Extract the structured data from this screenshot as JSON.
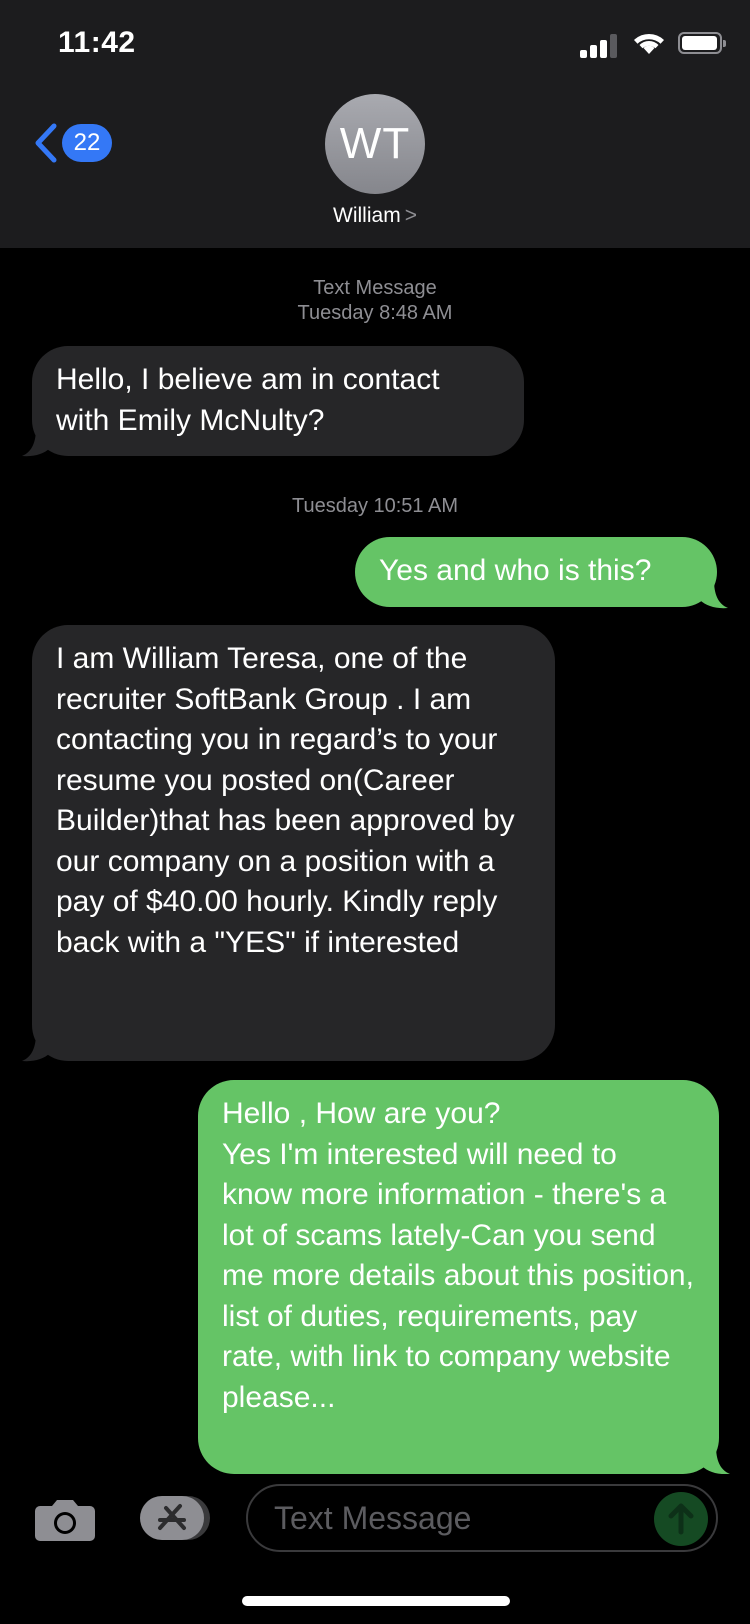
{
  "status_bar": {
    "time": "11:42"
  },
  "header": {
    "back_count": "22",
    "avatar_initials": "WT",
    "contact_name": "William",
    "contact_chevron": ">"
  },
  "conversation": {
    "service_label": "Text Message",
    "timestamps": [
      "Tuesday 8:48 AM",
      "Tuesday 10:51 AM"
    ],
    "messages": [
      {
        "direction": "incoming",
        "text": "Hello, I believe am in contact with Emily McNulty?"
      },
      {
        "direction": "outgoing",
        "text": "Yes and who is this?"
      },
      {
        "direction": "incoming",
        "text": "I am William Teresa, one of the recruiter SoftBank Group . I am contacting you in regard’s to your  resume you posted on(Career Builder)that has been approved by our company on a position with a pay of $40.00 hourly. Kindly reply back with a \"YES\" if interested"
      },
      {
        "direction": "outgoing",
        "text": "Hello , How are you?\nYes I'm interested will need to know more information - there's a lot of scams lately-Can you send me more details about this position, list of duties, requirements, pay rate, with link to company website please..."
      }
    ]
  },
  "composer": {
    "placeholder": "Text Message"
  },
  "colors": {
    "incoming_bubble": "#262628",
    "outgoing_bubble": "#65c466",
    "accent": "#3478f6",
    "header_bg": "#1c1c1e"
  },
  "icons": [
    "signal-icon",
    "wifi-icon",
    "battery-icon",
    "back-chevron-icon",
    "camera-icon",
    "app-store-icon",
    "send-arrow-icon"
  ]
}
